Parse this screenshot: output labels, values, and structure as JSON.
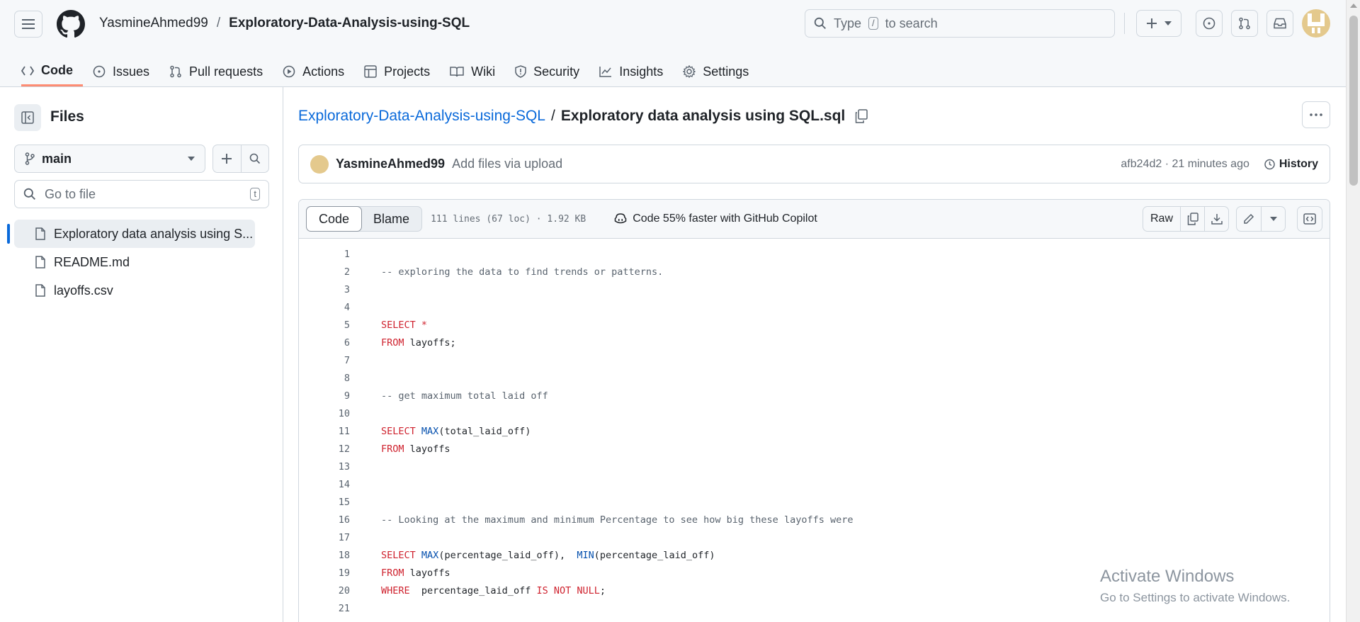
{
  "header": {
    "owner": "YasmineAhmed99",
    "separator": "/",
    "repo": "Exploratory-Data-Analysis-using-SQL",
    "search_prefix": "Type",
    "search_key": "/",
    "search_suffix": "to search"
  },
  "tabs": [
    {
      "label": "Code",
      "icon": "code-icon"
    },
    {
      "label": "Issues",
      "icon": "issue-icon"
    },
    {
      "label": "Pull requests",
      "icon": "pull-request-icon"
    },
    {
      "label": "Actions",
      "icon": "play-icon"
    },
    {
      "label": "Projects",
      "icon": "table-icon"
    },
    {
      "label": "Wiki",
      "icon": "book-icon"
    },
    {
      "label": "Security",
      "icon": "shield-icon"
    },
    {
      "label": "Insights",
      "icon": "graph-icon"
    },
    {
      "label": "Settings",
      "icon": "gear-icon"
    }
  ],
  "sidebar": {
    "title": "Files",
    "branch": "main",
    "goto_placeholder": "Go to file",
    "goto_key": "t",
    "files": [
      {
        "name": "Exploratory data analysis using S...",
        "selected": true
      },
      {
        "name": "README.md",
        "selected": false
      },
      {
        "name": "layoffs.csv",
        "selected": false
      }
    ]
  },
  "main": {
    "repo_link": "Exploratory-Data-Analysis-using-SQL",
    "path_sep": "/",
    "file_name": "Exploratory data analysis using SQL.sql",
    "commit": {
      "user": "YasmineAhmed99",
      "message": "Add files via upload",
      "meta": "afb24d2 · 21 minutes ago",
      "history": "History"
    },
    "toolbar": {
      "code": "Code",
      "blame": "Blame",
      "meta": "111 lines (67 loc) · 1.92 KB",
      "copilot": "Code 55% faster with GitHub Copilot",
      "raw": "Raw"
    }
  },
  "code_lines": [
    {
      "n": "1",
      "tokens": []
    },
    {
      "n": "2",
      "tokens": [
        {
          "t": "-- exploring the data to find trends or patterns.",
          "c": "cm"
        }
      ]
    },
    {
      "n": "3",
      "tokens": []
    },
    {
      "n": "4",
      "tokens": []
    },
    {
      "n": "5",
      "tokens": [
        {
          "t": "SELECT *",
          "c": "kw"
        }
      ]
    },
    {
      "n": "6",
      "tokens": [
        {
          "t": "FROM",
          "c": "kw"
        },
        {
          "t": " layoffs;",
          "c": ""
        }
      ]
    },
    {
      "n": "7",
      "tokens": []
    },
    {
      "n": "8",
      "tokens": []
    },
    {
      "n": "9",
      "tokens": [
        {
          "t": "-- get maximum total laid off",
          "c": "cm"
        }
      ]
    },
    {
      "n": "10",
      "tokens": []
    },
    {
      "n": "11",
      "tokens": [
        {
          "t": "SELECT",
          "c": "kw"
        },
        {
          "t": " ",
          "c": ""
        },
        {
          "t": "MAX",
          "c": "fn"
        },
        {
          "t": "(total_laid_off)",
          "c": ""
        }
      ]
    },
    {
      "n": "12",
      "tokens": [
        {
          "t": "FROM",
          "c": "kw"
        },
        {
          "t": " layoffs",
          "c": ""
        }
      ]
    },
    {
      "n": "13",
      "tokens": []
    },
    {
      "n": "14",
      "tokens": []
    },
    {
      "n": "15",
      "tokens": []
    },
    {
      "n": "16",
      "tokens": [
        {
          "t": "-- Looking at the maximum and minimum Percentage to see how big these layoffs were",
          "c": "cm"
        }
      ]
    },
    {
      "n": "17",
      "tokens": []
    },
    {
      "n": "18",
      "tokens": [
        {
          "t": "SELECT",
          "c": "kw"
        },
        {
          "t": " ",
          "c": ""
        },
        {
          "t": "MAX",
          "c": "fn"
        },
        {
          "t": "(percentage_laid_off),  ",
          "c": ""
        },
        {
          "t": "MIN",
          "c": "fn"
        },
        {
          "t": "(percentage_laid_off)",
          "c": ""
        }
      ]
    },
    {
      "n": "19",
      "tokens": [
        {
          "t": "FROM",
          "c": "kw"
        },
        {
          "t": " layoffs",
          "c": ""
        }
      ]
    },
    {
      "n": "20",
      "tokens": [
        {
          "t": "WHERE",
          "c": "kw"
        },
        {
          "t": "  percentage_laid_off ",
          "c": ""
        },
        {
          "t": "IS NOT NULL",
          "c": "kw"
        },
        {
          "t": ";",
          "c": ""
        }
      ]
    },
    {
      "n": "21",
      "tokens": []
    }
  ],
  "watermark": {
    "line1": "Activate Windows",
    "line2": "Go to Settings to activate Windows."
  }
}
